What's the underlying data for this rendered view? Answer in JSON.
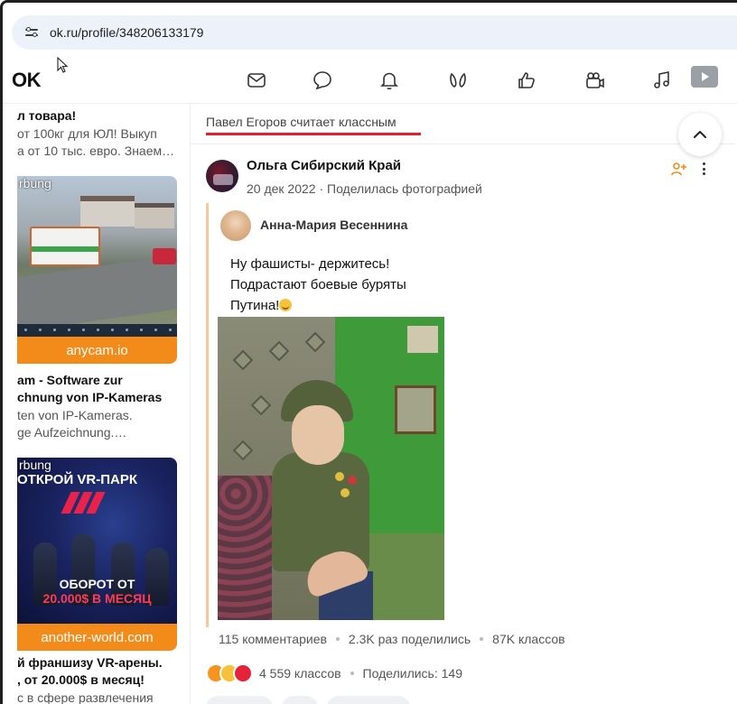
{
  "browser": {
    "url": "ok.ru/profile/348206133179",
    "site_icon": "site-settings-icon"
  },
  "ok_header": {
    "logo": "OK",
    "nav_icons": [
      "messages-icon",
      "discussions-icon",
      "notifications-icon",
      "guests-icon",
      "marks-icon",
      "video-call-icon",
      "music-icon",
      "video-icon"
    ]
  },
  "ads": {
    "ad1_title": "л товара!",
    "ad1_desc_1": "от 100кг для ЮЛ! Выкуп",
    "ad1_desc_2": "а от 10 тыс. евро. Знаем…",
    "ad2_source": "rbung",
    "ad2_banner": "anycam.io",
    "ad2_title_1": "am - Software zur",
    "ad2_title_2": "chnung von IP-Kameras",
    "ad2_desc_1": "ten von IP-Kameras.",
    "ad2_desc_2": "ge Aufzeichnung.…",
    "ad3_source": "rbung",
    "ad3_headline": "ОТКРОЙ VR-ПАРК",
    "ad3_big_1": "ОБОРОТ ОТ",
    "ad3_big_2": "20.000$ В МЕСЯЦ",
    "ad3_banner": "another-world.com",
    "ad3_title_1": "й франшизу VR-арены.",
    "ad3_title_2": ", от 20.000$ в месяц!",
    "ad3_desc_1": "с в сфере развлечения"
  },
  "feed": {
    "header": "Павел Егоров считает классным",
    "accent": "#e0222f",
    "post": {
      "author": "Ольга Сибирский Край",
      "meta": "20 дек 2022 · Поделилась фотографией",
      "original_author": "Анна-Мария Весеннина",
      "text_lines": [
        "Ну фашисты- держитесь!",
        "Подрастают боевые буряты",
        "Путина!"
      ],
      "stats": {
        "comments": "115 комментариев",
        "shares": "2.3K раз поделились",
        "classes": "87K классов"
      },
      "reactions_count": "4 559 классов",
      "shared_count": "Поделились: 149"
    }
  },
  "colors": {
    "ok_orange": "#f38b1b",
    "repost_border": "#f7c89c"
  }
}
